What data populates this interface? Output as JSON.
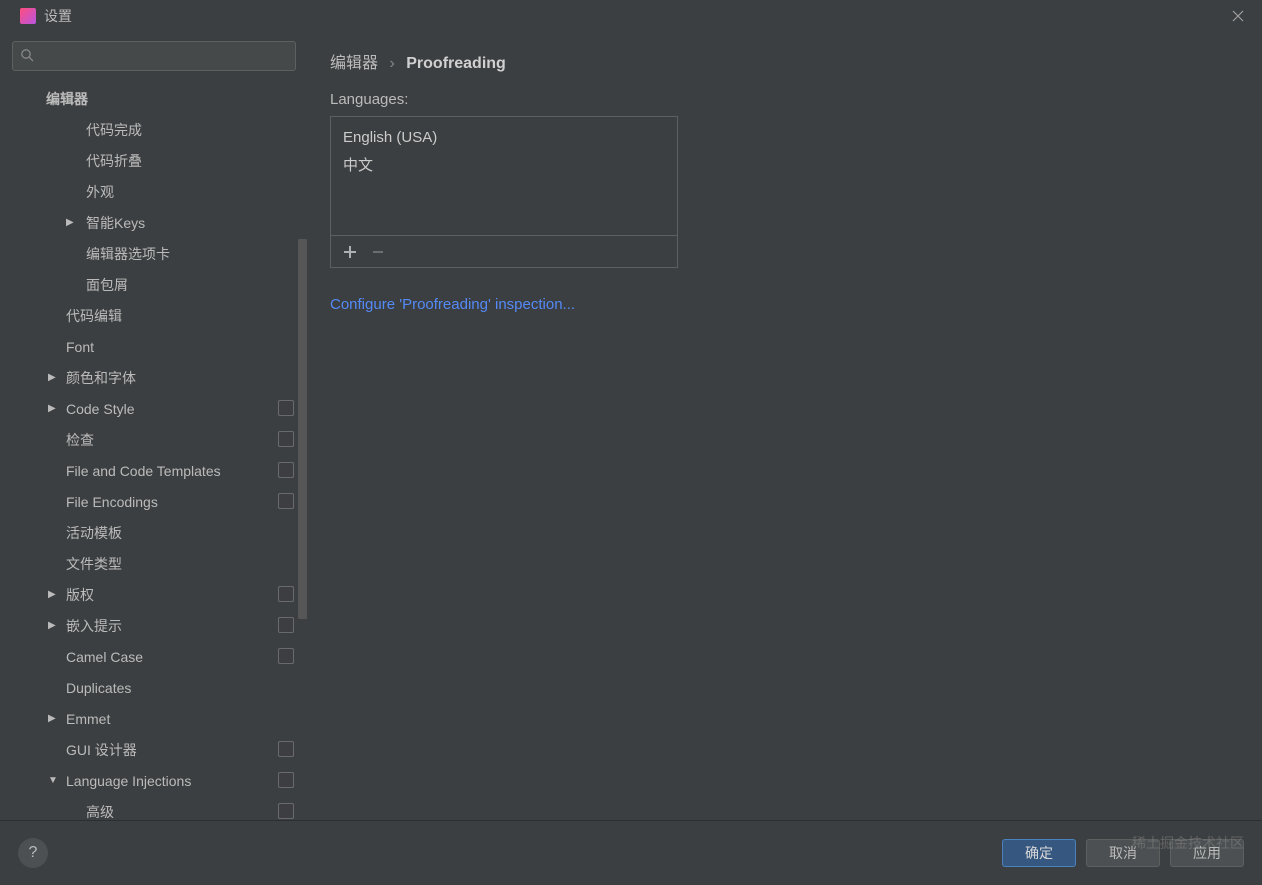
{
  "titlebar": {
    "title": "设置"
  },
  "search": {
    "placeholder": ""
  },
  "tree": {
    "header": "编辑器",
    "items": [
      {
        "label": "代码完成",
        "indent": 2
      },
      {
        "label": "代码折叠",
        "indent": 2
      },
      {
        "label": "外观",
        "indent": 2
      },
      {
        "label": "智能Keys",
        "indent": 2,
        "arrow": "right"
      },
      {
        "label": "编辑器选项卡",
        "indent": 2
      },
      {
        "label": "面包屑",
        "indent": 2
      },
      {
        "label": "代码编辑",
        "indent": 1
      },
      {
        "label": "Font",
        "indent": 1
      },
      {
        "label": "颜色和字体",
        "indent": 1,
        "arrow": "right"
      },
      {
        "label": "Code Style",
        "indent": 1,
        "arrow": "right",
        "badge": true
      },
      {
        "label": "检查",
        "indent": 1,
        "badge": true
      },
      {
        "label": "File and Code Templates",
        "indent": 1,
        "badge": true
      },
      {
        "label": "File Encodings",
        "indent": 1,
        "badge": true
      },
      {
        "label": "活动模板",
        "indent": 1
      },
      {
        "label": "文件类型",
        "indent": 1
      },
      {
        "label": "版权",
        "indent": 1,
        "arrow": "right",
        "badge": true
      },
      {
        "label": "嵌入提示",
        "indent": 1,
        "arrow": "right",
        "badge": true
      },
      {
        "label": "Camel Case",
        "indent": 1,
        "badge": true
      },
      {
        "label": "Duplicates",
        "indent": 1
      },
      {
        "label": "Emmet",
        "indent": 1,
        "arrow": "right"
      },
      {
        "label": "GUI 设计器",
        "indent": 1,
        "badge": true
      },
      {
        "label": "Language Injections",
        "indent": 1,
        "arrow": "down",
        "badge": true
      },
      {
        "label": "高级",
        "indent": 2,
        "badge": true
      }
    ]
  },
  "breadcrumb": {
    "root": "编辑器",
    "current": "Proofreading"
  },
  "main": {
    "languages_label": "Languages:",
    "languages": [
      "English (USA)",
      "中文"
    ],
    "configure_link": "Configure 'Proofreading' inspection..."
  },
  "footer": {
    "ok": "确定",
    "cancel": "取消",
    "apply": "应用"
  },
  "watermark": "稀土掘金技术社区"
}
